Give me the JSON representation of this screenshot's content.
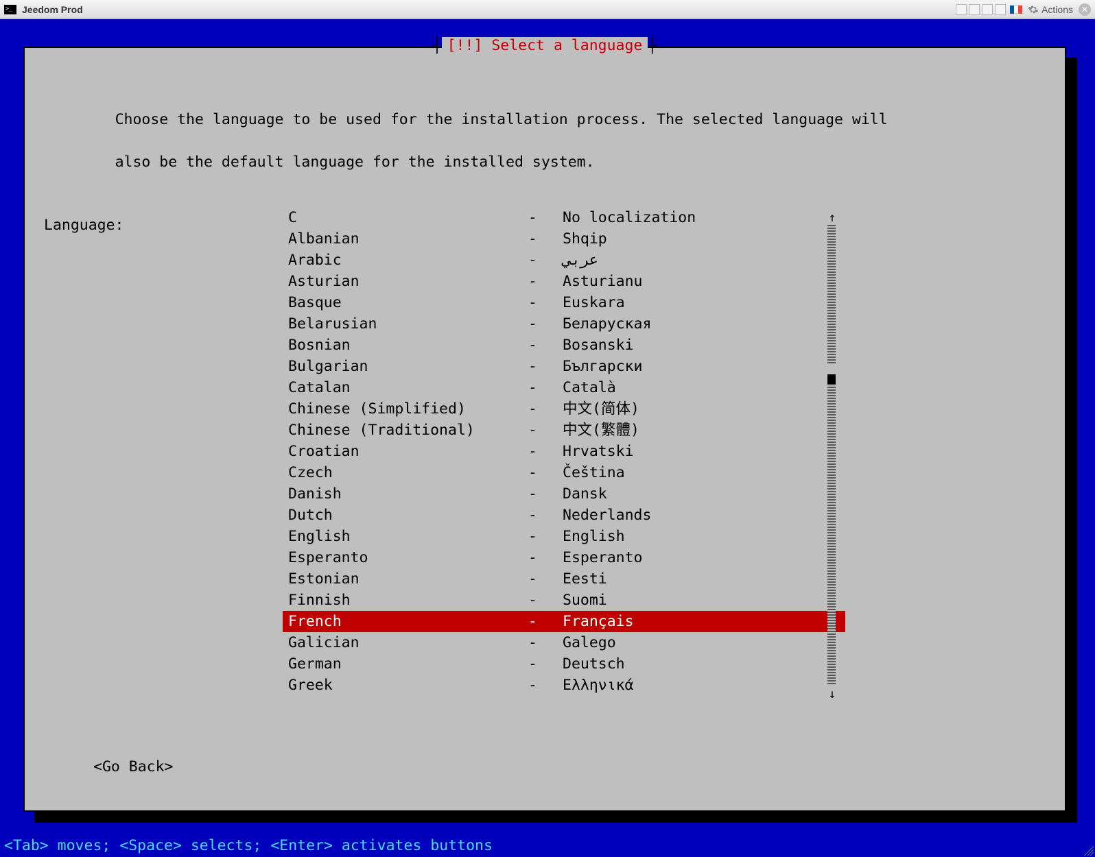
{
  "window": {
    "title": "Jeedom Prod",
    "actions_label": "Actions"
  },
  "dialog": {
    "title": "[!!] Select a language",
    "instructions_line1": "Choose the language to be used for the installation process. The selected language will",
    "instructions_line2": "also be the default language for the installed system.",
    "label": "Language:",
    "go_back": "<Go Back>"
  },
  "languages": [
    {
      "english": "C",
      "sep": "-",
      "native": "No localization",
      "selected": false
    },
    {
      "english": "Albanian",
      "sep": "-",
      "native": "Shqip",
      "selected": false
    },
    {
      "english": "Arabic",
      "sep": "-",
      "native": "عربي",
      "selected": false
    },
    {
      "english": "Asturian",
      "sep": "-",
      "native": "Asturianu",
      "selected": false
    },
    {
      "english": "Basque",
      "sep": "-",
      "native": "Euskara",
      "selected": false
    },
    {
      "english": "Belarusian",
      "sep": "-",
      "native": "Беларуская",
      "selected": false
    },
    {
      "english": "Bosnian",
      "sep": "-",
      "native": "Bosanski",
      "selected": false
    },
    {
      "english": "Bulgarian",
      "sep": "-",
      "native": "Български",
      "selected": false
    },
    {
      "english": "Catalan",
      "sep": "-",
      "native": "Català",
      "selected": false
    },
    {
      "english": "Chinese (Simplified)",
      "sep": "-",
      "native": "中文(简体)",
      "selected": false
    },
    {
      "english": "Chinese (Traditional)",
      "sep": "-",
      "native": "中文(繁體)",
      "selected": false
    },
    {
      "english": "Croatian",
      "sep": "-",
      "native": "Hrvatski",
      "selected": false
    },
    {
      "english": "Czech",
      "sep": "-",
      "native": "Čeština",
      "selected": false
    },
    {
      "english": "Danish",
      "sep": "-",
      "native": "Dansk",
      "selected": false
    },
    {
      "english": "Dutch",
      "sep": "-",
      "native": "Nederlands",
      "selected": false
    },
    {
      "english": "English",
      "sep": "-",
      "native": "English",
      "selected": false
    },
    {
      "english": "Esperanto",
      "sep": "-",
      "native": "Esperanto",
      "selected": false
    },
    {
      "english": "Estonian",
      "sep": "-",
      "native": "Eesti",
      "selected": false
    },
    {
      "english": "Finnish",
      "sep": "-",
      "native": "Suomi",
      "selected": false
    },
    {
      "english": "French",
      "sep": "-",
      "native": "Français",
      "selected": true
    },
    {
      "english": "Galician",
      "sep": "-",
      "native": "Galego",
      "selected": false
    },
    {
      "english": "German",
      "sep": "-",
      "native": "Deutsch",
      "selected": false
    },
    {
      "english": "Greek",
      "sep": "-",
      "native": "Ελληνικά",
      "selected": false
    }
  ],
  "footer": {
    "help": "<Tab> moves; <Space> selects; <Enter> activates buttons"
  },
  "scroll": {
    "up": "↑",
    "down": "↓"
  }
}
